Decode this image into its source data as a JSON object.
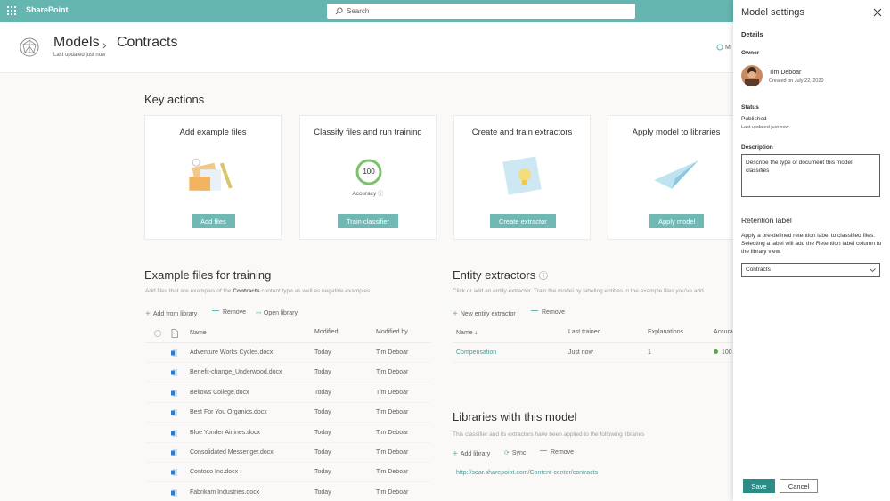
{
  "suitebar": {
    "app_name": "SharePoint",
    "search_placeholder": "Search",
    "brand_color": "#65b5b1"
  },
  "header": {
    "breadcrumb_root": "Models",
    "breadcrumb_current": "Contracts",
    "last_updated": "Last updated just now",
    "action_label": "M"
  },
  "key_actions": {
    "title": "Key actions",
    "cards": [
      {
        "title": "Add example files",
        "button": "Add files"
      },
      {
        "title": "Classify files and run training",
        "button": "Train classifier",
        "score": "100",
        "score_label": "Accuracy"
      },
      {
        "title": "Create and train extractors",
        "button": "Create extractor"
      },
      {
        "title": "Apply model to libraries",
        "button": "Apply model"
      }
    ]
  },
  "example_files": {
    "title": "Example files for training",
    "desc_prefix": "Add files that are examples of the ",
    "desc_bold": "Contracts",
    "desc_suffix": " content type as well as negative examples",
    "commands": {
      "add": "Add from library",
      "remove": "Remove",
      "open": "Open library"
    },
    "columns": {
      "name": "Name",
      "modified": "Modified",
      "modified_by": "Modified by"
    },
    "rows": [
      {
        "name": "Adventure Works Cycles.docx",
        "modified": "Today",
        "by": "Tim Deboar"
      },
      {
        "name": "Benefit-change_Underwood.docx",
        "modified": "Today",
        "by": "Tim Deboar"
      },
      {
        "name": "Bellows College.docx",
        "modified": "Today",
        "by": "Tim Deboar"
      },
      {
        "name": "Best For You Organics.docx",
        "modified": "Today",
        "by": "Tim Deboar"
      },
      {
        "name": "Blue Yonder Airlines.docx",
        "modified": "Today",
        "by": "Tim Deboar"
      },
      {
        "name": "Consolidated Messenger.docx",
        "modified": "Today",
        "by": "Tim Deboar"
      },
      {
        "name": "Contoso Inc.docx",
        "modified": "Today",
        "by": "Tim Deboar"
      },
      {
        "name": "Fabrikam Industries.docx",
        "modified": "Today",
        "by": "Tim Deboar"
      }
    ]
  },
  "entity_extractors": {
    "title": "Entity extractors",
    "desc": "Click or add an entity extractor. Train the model by labeling entities in the example files you've add",
    "commands": {
      "add": "New entity extractor",
      "remove": "Remove"
    },
    "columns": {
      "name": "Name ↓",
      "last_trained": "Last trained",
      "explanations": "Explanations",
      "accuracy": "Accura"
    },
    "rows": [
      {
        "name": "Compensation",
        "last_trained": "Just now",
        "explanations": "1",
        "accuracy": "100"
      }
    ]
  },
  "libraries": {
    "title": "Libraries with this model",
    "desc": "This classifier and its extractors have been applied to the following libraries",
    "commands": {
      "add": "Add library",
      "sync": "Sync",
      "remove": "Remove"
    },
    "link": "http://soar.sharepoint.com/Content-center/contracts"
  },
  "panel": {
    "title": "Model settings",
    "details_label": "Details",
    "owner_label": "Owner",
    "owner_name": "Tim Deboar",
    "owner_created": "Created on July 22, 2020",
    "status_label": "Status",
    "status_value": "Published",
    "status_updated": "Last updated just now",
    "description_label": "Description",
    "description_value": "Describe the type of document this model classifies",
    "retention_label": "Retention label",
    "retention_desc": "Apply a pre-defined retention label to classified files. Selecting a label will add the Retention label column to the library view.",
    "retention_value": "Contracts",
    "save": "Save",
    "cancel": "Cancel"
  }
}
